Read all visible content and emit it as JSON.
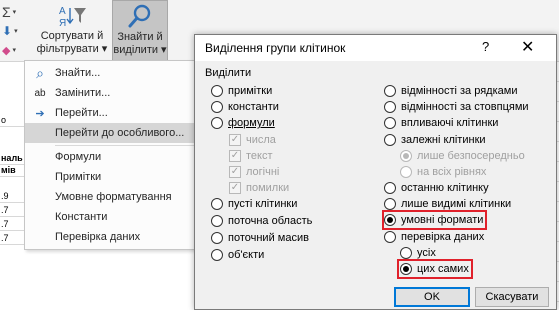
{
  "ribbon": {
    "tools": [
      {
        "icon": "autosum-icon",
        "glyph": "Σ"
      },
      {
        "icon": "fill-down-icon",
        "glyph": "⬇"
      },
      {
        "icon": "clear-eraser-icon",
        "glyph": "◆"
      }
    ],
    "sort_filter": {
      "line1": "Сортувати й",
      "line2": "фільтрувати ▾"
    },
    "find_select": {
      "line1": "Знайти й",
      "line2": "виділити ▾"
    }
  },
  "sheet": {
    "cells": [
      {
        "text": "о"
      },
      {
        "text": "наль"
      },
      {
        "text": "мів"
      },
      {
        "text": ".9"
      },
      {
        "text": ".7"
      },
      {
        "text": ".7"
      },
      {
        "text": ".7"
      }
    ]
  },
  "menu": {
    "items": [
      {
        "label": "Знайти...",
        "icon": "search-icon",
        "glyph": "⌕"
      },
      {
        "label": "Замінити...",
        "icon": "replace-icon",
        "glyph": "ab"
      },
      {
        "label": "Перейти...",
        "icon": "go-to-arrow-icon",
        "glyph": "➔"
      },
      {
        "label": "Перейти до особливого...",
        "icon": "",
        "glyph": ""
      },
      {
        "label": "Формули",
        "icon": "",
        "glyph": ""
      },
      {
        "label": "Примітки",
        "icon": "",
        "glyph": ""
      },
      {
        "label": "Умовне форматування",
        "icon": "",
        "glyph": ""
      },
      {
        "label": "Константи",
        "icon": "",
        "glyph": ""
      },
      {
        "label": "Перевірка даних",
        "icon": "",
        "glyph": ""
      }
    ]
  },
  "dialog": {
    "title": "Виділення групи клітинок",
    "help": "?",
    "close": "✕",
    "group_label": "Виділити",
    "left_options": {
      "notes": "примітки",
      "constants": "константи",
      "formulas": "формули",
      "formula_numbers": "числа",
      "formula_text": "текст",
      "formula_logical": "логічні",
      "formula_errors": "помилки",
      "blanks": "пусті клітинки",
      "current_region": "поточна область",
      "current_array": "поточний масив",
      "objects": "об'єкти"
    },
    "right_options": {
      "row_differences": "відмінності за рядками",
      "column_differences": "відмінності за стовпцями",
      "precedents": "впливаючі клітинки",
      "dependents": "залежні клітинки",
      "direct_only": "лише безпосередньо",
      "all_levels": "на всіх рівнях",
      "last_cell": "останню клітинку",
      "visible_only": "лише видимі клітинки",
      "conditional_formats": "умовні формати",
      "data_validation": "перевірка даних",
      "dv_all": "усіх",
      "dv_same": "цих самих"
    },
    "selected": "conditional_formats",
    "validation_selected": "dv_same",
    "ok_label": "OK",
    "cancel_label": "Скасувати",
    "highlight_color": "#e0212b"
  }
}
